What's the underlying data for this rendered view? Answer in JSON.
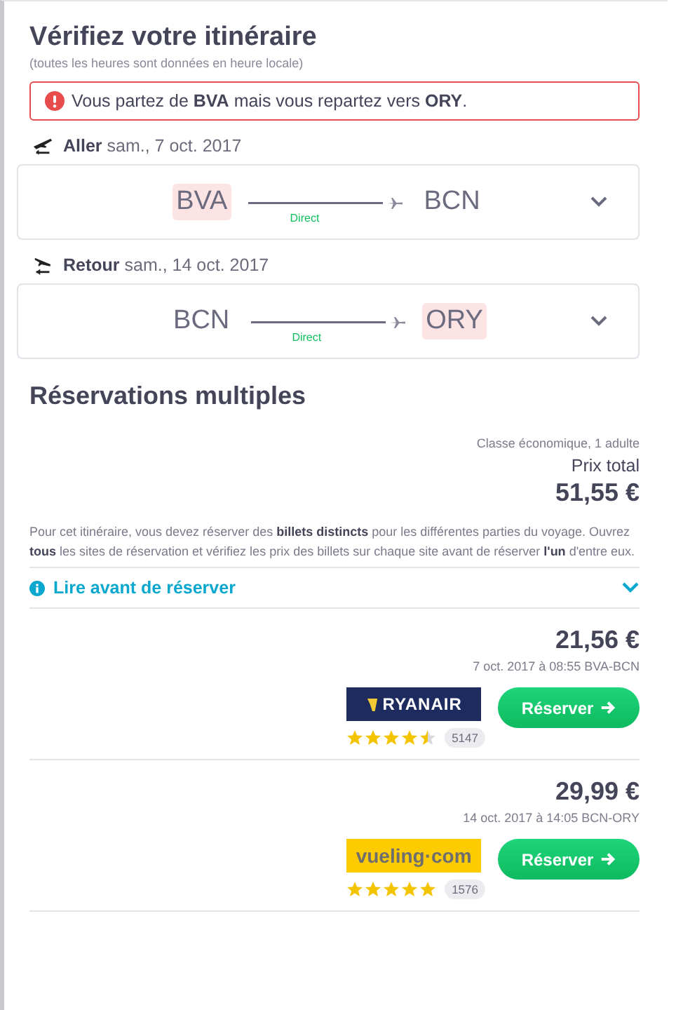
{
  "title": "Vérifiez votre itinéraire",
  "subtitle": "(toutes les heures sont données en heure locale)",
  "alert": "Vous partez de **BVA** mais vous repartez vers **ORY**.",
  "legs": [
    {
      "kind": "outbound",
      "label": "Aller",
      "date": "sam., 7 oct. 2017",
      "from": {
        "code": "BVA",
        "highlighted": true
      },
      "to": {
        "code": "BCN",
        "highlighted": false
      },
      "stops": "Direct",
      "expanded": false
    },
    {
      "kind": "return",
      "label": "Retour",
      "date": "sam., 14 oct. 2017",
      "from": {
        "code": "BCN",
        "highlighted": false
      },
      "to": {
        "code": "ORY",
        "highlighted": true
      },
      "stops": "Direct",
      "expanded": false
    }
  ],
  "section_title": "Réservations multiples",
  "fare_class": "Classe économique, 1 adulte",
  "total_label": "Prix total",
  "total_price": "51,55 €",
  "notice": "Pour cet itinéraire, vous devez réserver des **billets distincts** pour les différentes parties du voyage. Ouvrez **tous** les sites de réservation et vérifiez les prix des billets sur chaque site avant de réserver **l'un** d'entre eux.",
  "read_before": {
    "label": "Lire avant de réserver",
    "expanded": false
  },
  "offers": [
    {
      "kind": "ryanair",
      "price": "21,56 €",
      "details": "7 oct. 2017 à 08:55 BVA-BCN",
      "logo": "RYANAIR",
      "button": "Réserver",
      "stars": 4.5,
      "reviews": "5147"
    },
    {
      "kind": "vueling",
      "price": "29,99 €",
      "details": "14 oct. 2017 à 14:05 BCN-ORY",
      "logo": "vueling·com",
      "button": "Réserver",
      "stars": 5,
      "reviews": "1576"
    }
  ]
}
